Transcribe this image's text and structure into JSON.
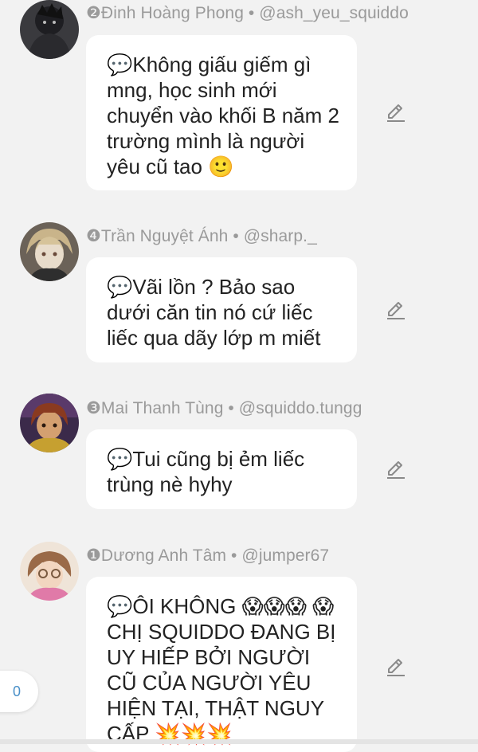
{
  "comments": [
    {
      "meta": "❷Đinh Hoàng Phong • @ash_yeu_squiddo",
      "text": "💬Không giấu giếm gì mng, học sinh mới chuyển vào khối B năm 2 trường mình là người yêu cũ tao 🙂"
    },
    {
      "meta": "❹Trần Nguyệt Ánh • @sharp._",
      "text": "💬Vãi lồn ? Bảo sao dưới căn tin nó cứ liếc liếc qua dãy lớp m miết"
    },
    {
      "meta": "❸Mai Thanh Tùng • @squiddo.tungg",
      "text": "💬Tui cũng bị ẻm liếc trùng nè hyhy"
    },
    {
      "meta": "❶Dương Anh Tâm • @jumper67",
      "text": "💬ÔI KHÔNG 😱😱😱 😱 CHỊ SQUIDDO ĐANG BỊ UY HIẾP BỞI NGƯỜI CŨ CỦA NGƯỜI YÊU HIỆN TẠI, THẬT NGUY CẤP 💥💥💥"
    }
  ],
  "counter": "0",
  "colors": {
    "background": "#f2f2f2",
    "bubble": "#ffffff",
    "meta_text": "#9a9a9a",
    "counter_text": "#4a90c8"
  },
  "icons": {
    "edit": "pencil-icon"
  }
}
